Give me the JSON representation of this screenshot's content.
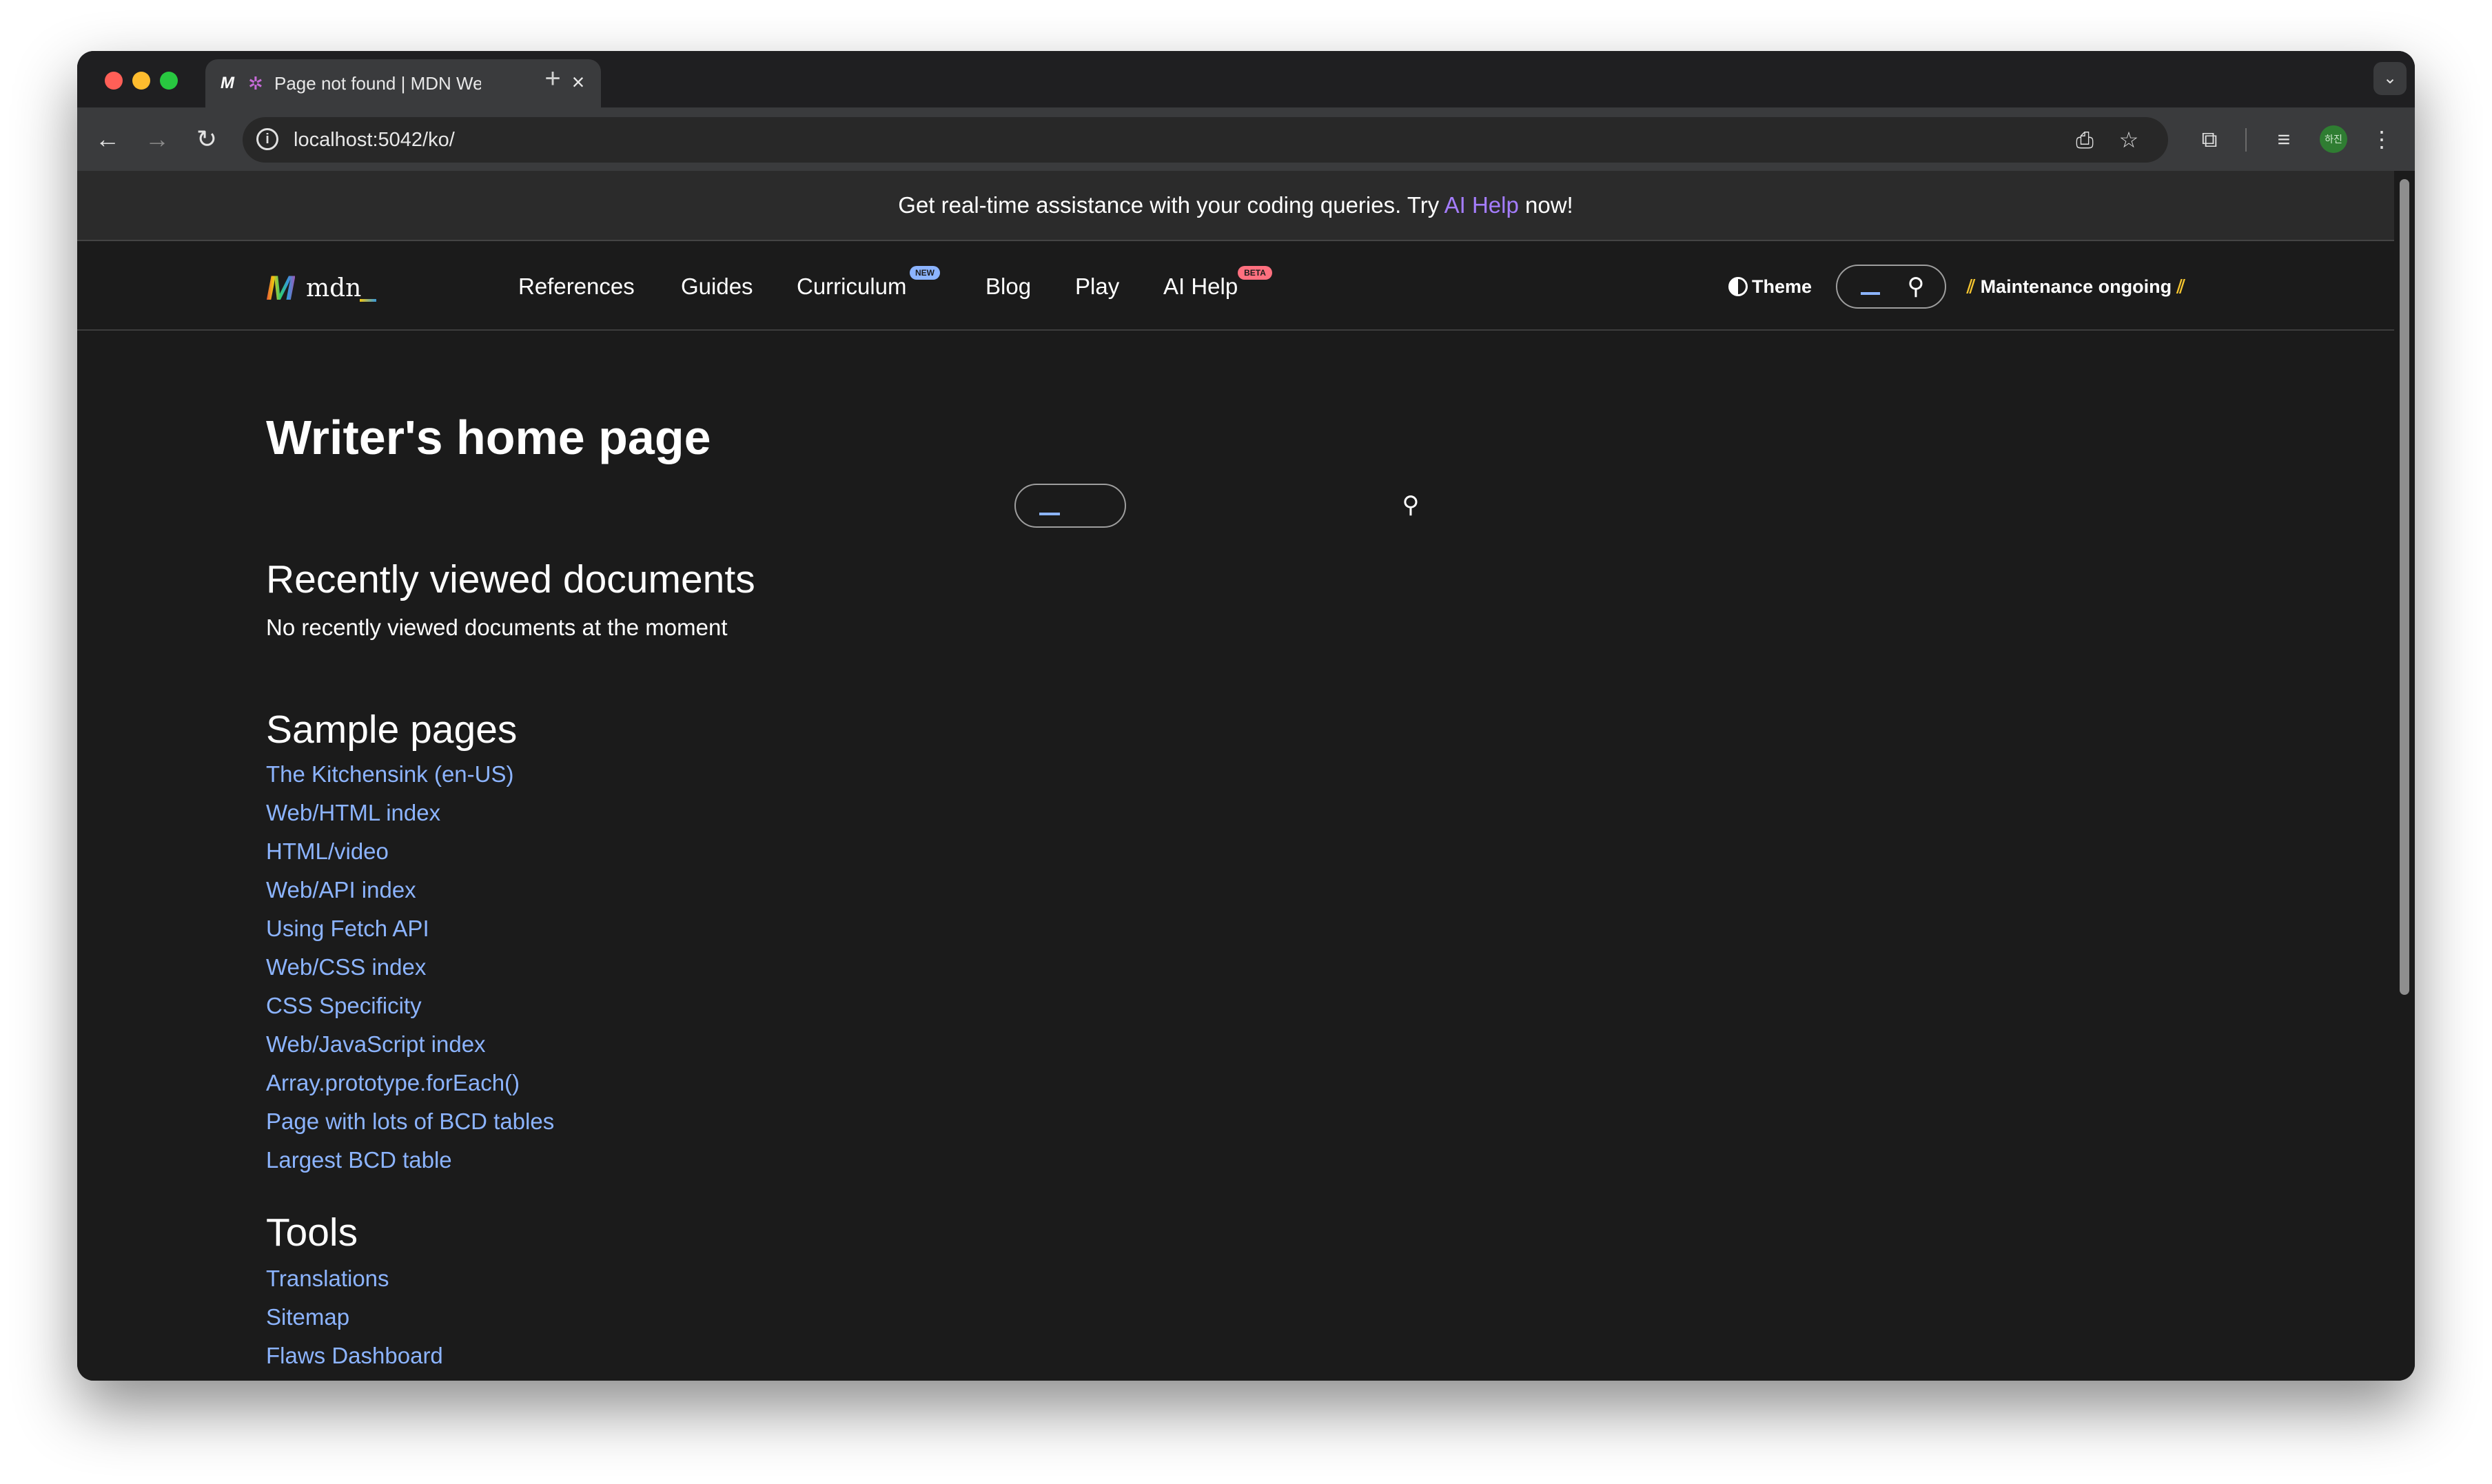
{
  "browser": {
    "tab_title": "Page not found | MDN Web Docs",
    "url": "localhost:5042/ko/",
    "profile_initials": "하진"
  },
  "banner": {
    "prefix": "Get real-time assistance with your coding queries. Try ",
    "link": "AI Help",
    "suffix": " now!"
  },
  "header": {
    "logo_text": "mdn",
    "nav": [
      {
        "label": "References"
      },
      {
        "label": "Guides"
      },
      {
        "label": "Curriculum",
        "badge": "NEW"
      },
      {
        "label": "Blog"
      },
      {
        "label": "Play"
      },
      {
        "label": "AI Help",
        "badge": "BETA"
      }
    ],
    "theme_label": "Theme",
    "maintenance_label": "Maintenance ongoing"
  },
  "main": {
    "title": "Writer's home page",
    "recent_heading": "Recently viewed documents",
    "recent_empty": "No recently viewed documents at the moment",
    "sample_heading": "Sample pages",
    "sample_links": [
      "The Kitchensink (en-US)",
      "Web/HTML index",
      "HTML/video",
      "Web/API index",
      "Using Fetch API",
      "Web/CSS index",
      "CSS Specificity",
      "Web/JavaScript index",
      "Array.prototype.forEach()",
      "Page with lots of BCD tables",
      "Largest BCD table"
    ],
    "tools_heading": "Tools",
    "tools_links": [
      "Translations",
      "Sitemap",
      "Flaws Dashboard"
    ]
  },
  "colors": {
    "link": "#8cb4ff",
    "ai_link": "#a57dff",
    "background": "#1b1b1b",
    "badge_new": "#8cb4ff",
    "badge_beta": "#ff707f"
  },
  "icons": {
    "back": "arrow-left-icon",
    "forward": "arrow-right-icon",
    "reload": "reload-icon",
    "site_info": "info-icon",
    "install": "install-icon",
    "bookmark": "star-icon",
    "extensions": "puzzle-icon",
    "media": "media-queue-icon",
    "menu": "kebab-menu-icon",
    "search": "search-icon",
    "theme": "half-circle-icon"
  }
}
